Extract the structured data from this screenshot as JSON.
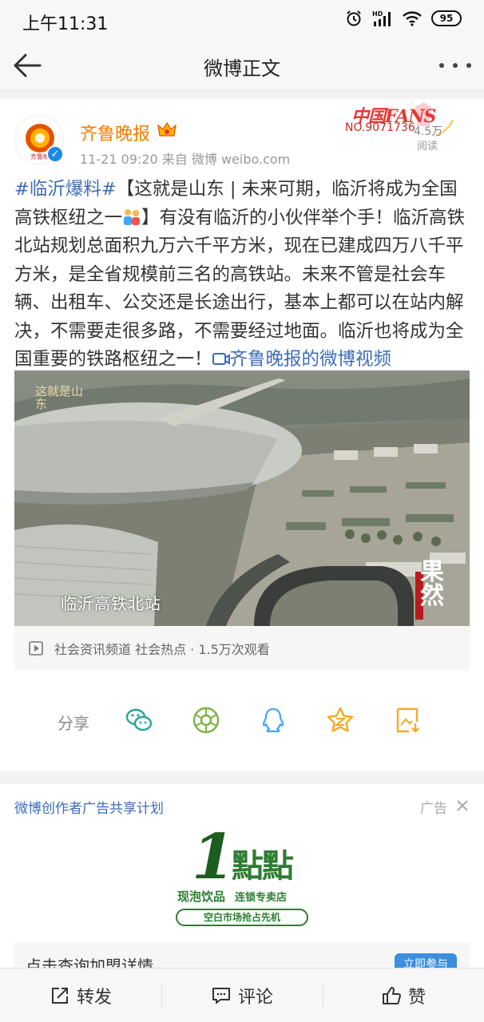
{
  "status_bar": {
    "time": "上午11:31",
    "battery": "95"
  },
  "nav": {
    "title": "微博正文"
  },
  "post": {
    "author": "齐鲁晚报",
    "meta": "11-21 09:20  来自 微博 weibo.com",
    "fans_badge": "中国FANS",
    "fans_number": "NO.9071736",
    "read_count": "4.5万",
    "read_label": "阅读",
    "hashtag": "#临沂爆料#",
    "text_part1": "【这就是山东 | 未来可期，临沂将成为全国高铁枢纽之一",
    "text_part2": "】有没有临沂的小伙伴举个手！临沂高铁北站规划总面积九万六千平方米，现在已建成四万八千平方米，是全省规模前三名的高铁站。未来不管是社会车辆、出租车、公交还是长途出行，基本上都可以在站内解决，不需要走很多路，不需要经过地面。临沂也将成为全国重要的铁路枢纽之一！",
    "video_link": "齐鲁晚报的微博视频",
    "video_caption": "临沂高铁北站",
    "watermark_left": "这就是山东",
    "watermark_right": "果然",
    "video_info": "社会资讯频道 社会热点 · 1.5万次观看"
  },
  "share": {
    "label": "分享",
    "icons": [
      "wechat-icon",
      "moments-icon",
      "qq-icon",
      "qzone-icon",
      "save-image-icon"
    ]
  },
  "ad": {
    "title": "微博创作者广告共享计划",
    "tag": "广告",
    "logo_number": "1",
    "logo_name": "點點",
    "slogan_a": "现泡饮品",
    "slogan_b": "连锁专卖店",
    "pill": "空白市场抢占先机",
    "bottom_text": "点击查询加盟详情",
    "button": "立即参与"
  },
  "toolbar": {
    "repost": "转发",
    "comment": "评论",
    "like": "赞"
  },
  "colors": {
    "link_blue": "#3d6cb9",
    "author_orange": "#f57c00"
  }
}
